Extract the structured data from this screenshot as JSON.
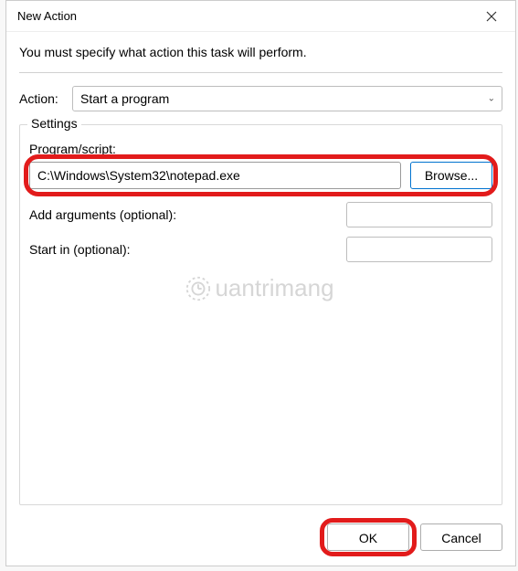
{
  "window": {
    "title": "New Action"
  },
  "instruction": "You must specify what action this task will perform.",
  "action": {
    "label": "Action:",
    "selected": "Start a program"
  },
  "settings": {
    "legend": "Settings",
    "program": {
      "label": "Program/script:",
      "value": "C:\\Windows\\System32\\notepad.exe",
      "browse": "Browse..."
    },
    "arguments": {
      "label": "Add arguments (optional):",
      "value": ""
    },
    "startin": {
      "label": "Start in (optional):",
      "value": ""
    }
  },
  "buttons": {
    "ok": "OK",
    "cancel": "Cancel"
  },
  "watermark": "uantrimang"
}
